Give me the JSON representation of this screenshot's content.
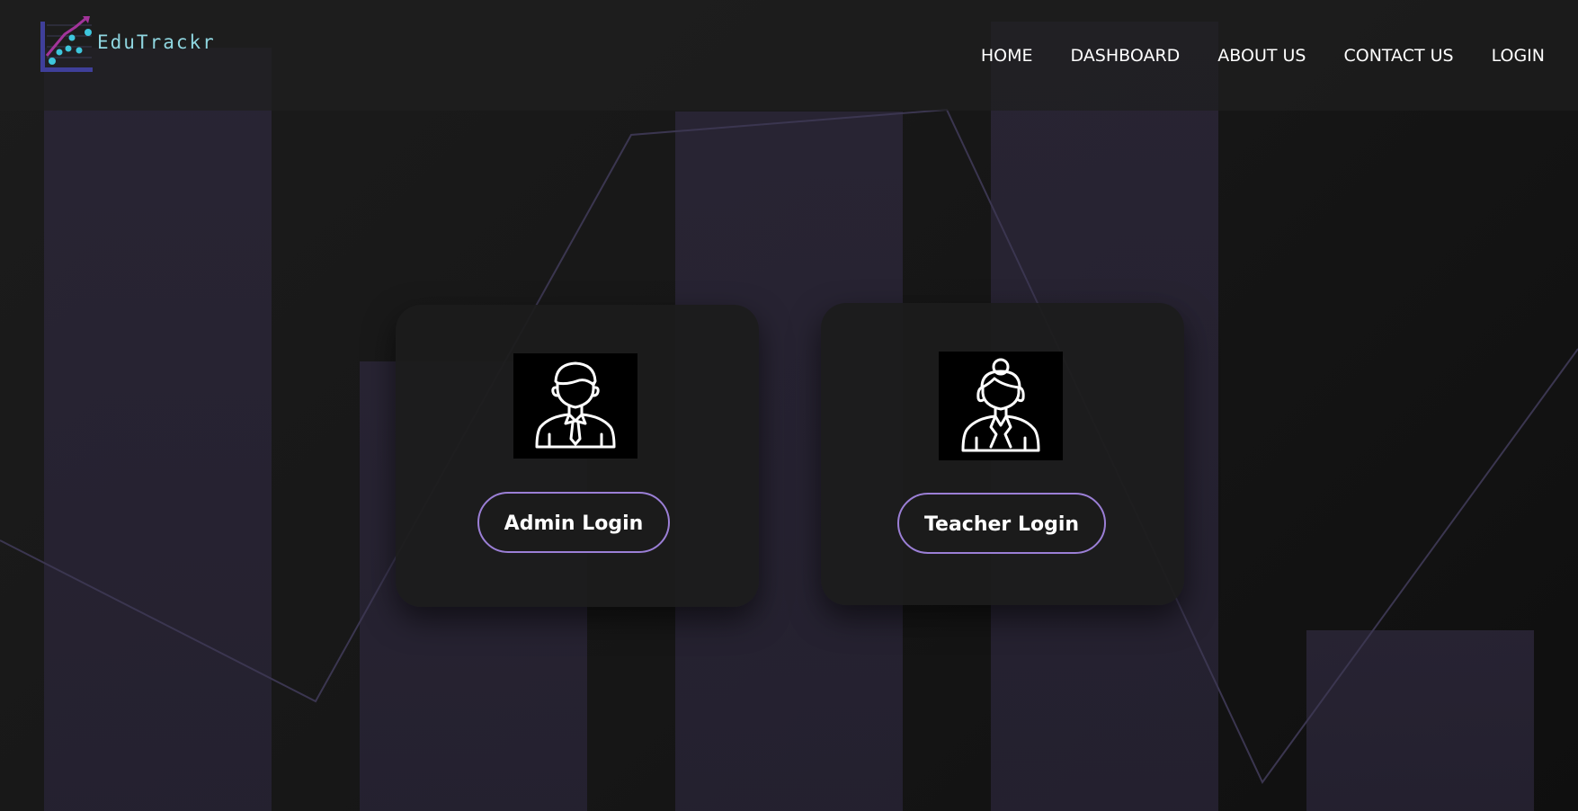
{
  "brand": {
    "name": "EduTrackr",
    "text_color": "#8fd6e0",
    "accent_colors": [
      "#3f3f9a",
      "#a2349a",
      "#3ec6dc"
    ]
  },
  "nav": {
    "items": [
      {
        "label": "HOME"
      },
      {
        "label": "DASHBOARD"
      },
      {
        "label": "ABOUT US"
      },
      {
        "label": "CONTACT US"
      },
      {
        "label": "LOGIN"
      }
    ]
  },
  "cards": {
    "admin": {
      "icon": "admin-person-icon",
      "button_label": "Admin Login"
    },
    "teacher": {
      "icon": "teacher-person-icon",
      "button_label": "Teacher Login"
    }
  },
  "colors": {
    "background": "#161616",
    "button_border": "#9b7fd6",
    "decor_bar": "#2a2537",
    "decor_line": "#3b3650"
  }
}
